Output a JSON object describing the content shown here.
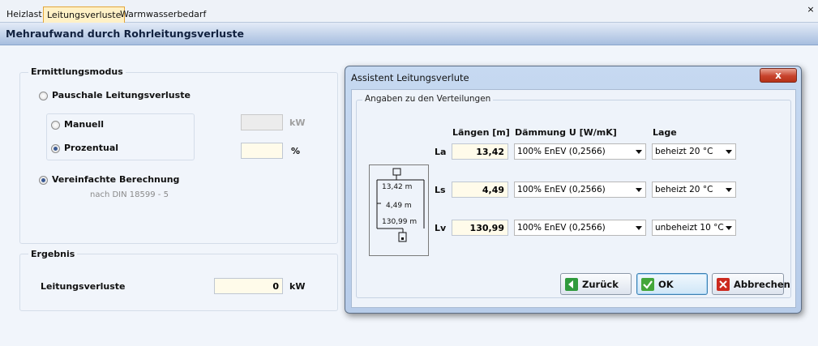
{
  "tabs": [
    {
      "label": "Heizlast"
    },
    {
      "label": "Leitungsverluste"
    },
    {
      "label": "Warmwasserbedarf"
    }
  ],
  "tab_close_glyph": "×",
  "header": {
    "title": "Mehraufwand durch Rohrleitungsverluste"
  },
  "mode_group": {
    "title": "Ermittlungsmodus",
    "option_flat": "Pauschale Leitungsverluste",
    "option_manual": "Manuell",
    "option_percent": "Prozentual",
    "option_simplified": "Vereinfachte Berechnung",
    "simplified_note": "nach DIN 18599 - 5",
    "manual_value": "",
    "manual_unit": "kW",
    "percent_value": "",
    "percent_unit": "%"
  },
  "result_group": {
    "title": "Ergebnis",
    "label": "Leitungsverluste",
    "value": "0",
    "unit": "kW"
  },
  "dialog": {
    "title": "Assistent Leitungsverlute",
    "close_glyph": "x",
    "group_title": "Angaben zu den Verteilungen",
    "col_length": "Längen [m]",
    "col_insulation": "Dämmung U [W/mK]",
    "col_location": "Lage",
    "rows": [
      {
        "label": "La",
        "length": "13,42",
        "insulation": "100% EnEV (0,2566)",
        "location": "beheizt 20 °C"
      },
      {
        "label": "Ls",
        "length": "4,49",
        "insulation": "100% EnEV (0,2566)",
        "location": "beheizt 20 °C"
      },
      {
        "label": "Lv",
        "length": "130,99",
        "insulation": "100% EnEV (0,2566)",
        "location": "unbeheizt 10 °C"
      }
    ],
    "diagram": {
      "la": "13,42 m",
      "ls": "4,49 m",
      "lv": "130,99 m"
    },
    "buttons": {
      "back": "Zurück",
      "ok": "OK",
      "cancel": "Abbrechen"
    }
  },
  "colors": {
    "accent_tab": "#fff1c6",
    "ok_icon": "#43a63a",
    "cancel_icon": "#cc2a1f",
    "back_icon": "#2f9a3c"
  }
}
